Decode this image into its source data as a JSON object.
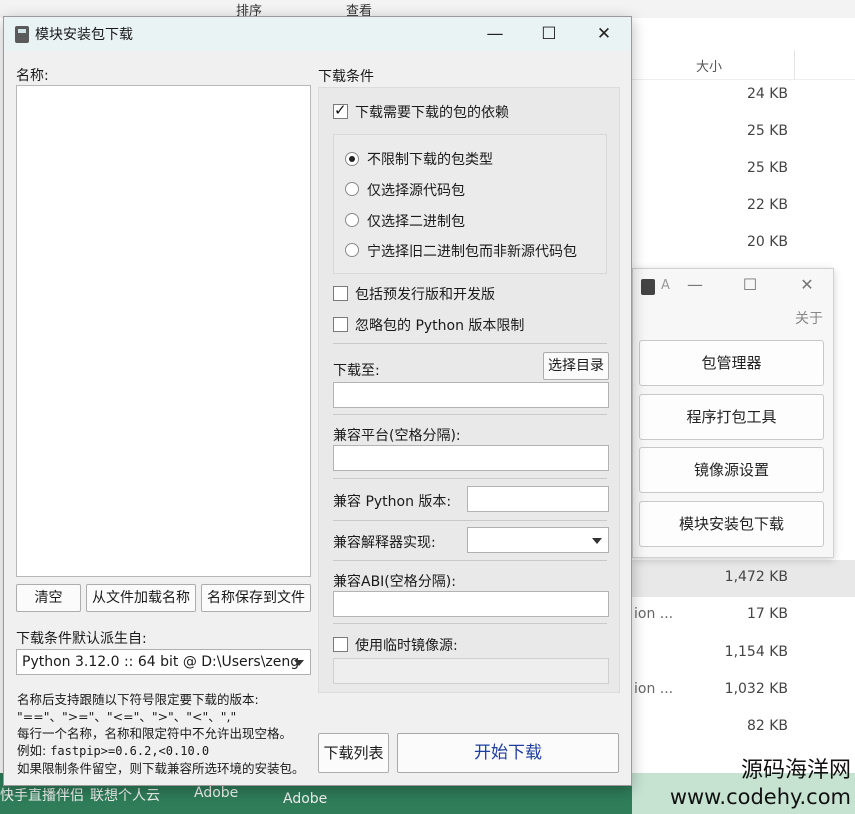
{
  "background": {
    "toolbar_items": [
      "排序",
      "查看"
    ],
    "size_header": "大小",
    "files": [
      {
        "name": "",
        "size": "24 KB"
      },
      {
        "name": "",
        "size": "25 KB"
      },
      {
        "name": "",
        "size": "25 KB"
      },
      {
        "name": "",
        "size": "22 KB"
      },
      {
        "name": "",
        "size": "20 KB"
      },
      {
        "name": "",
        "size": "1,472 KB",
        "selected": true
      },
      {
        "name": "ion ...",
        "size": "17 KB"
      },
      {
        "name": "",
        "size": "1,154 KB"
      },
      {
        "name": "ion ...",
        "size": "1,032 KB"
      },
      {
        "name": "",
        "size": "82 KB"
      }
    ],
    "taskbar_texts": [
      "快手直播伴侣",
      "联想个人云",
      "Adobe",
      "Adobe"
    ]
  },
  "mini_window": {
    "title": "A",
    "about": "关于",
    "buttons": [
      "包管理器",
      "程序打包工具",
      "镜像源设置",
      "模块安装包下载"
    ]
  },
  "dialog": {
    "title": "模块安装包下载",
    "names_label": "名称:",
    "clear_button": "清空",
    "load_button": "从文件加载名称",
    "save_button": "名称保存到文件",
    "derive_label": "下载条件默认派生自:",
    "python_select_value": "Python 3.12.0 :: 64 bit @ D:\\Users\\zeng",
    "hint_line1": "名称后支持跟随以下符号限定要下载的版本:",
    "hint_line2": "\"==\"、\">=\"、\"<=\"、\">\"、\"<\"、\",\"",
    "hint_line3": "每行一个名称，名称和限定符中不允许出现空格。",
    "hint_line4_prefix": "例如: ",
    "hint_line4_code": "fastpip>=0.6.2,<0.10.0",
    "hint_line5": "如果限制条件留空，则下载兼容所选环境的安装包。",
    "conditions_label": "下载条件",
    "deps_checkbox": "下载需要下载的包的依赖",
    "deps_checked": true,
    "radio_options": [
      "不限制下载的包类型",
      "仅选择源代码包",
      "仅选择二进制包",
      "宁选择旧二进制包而非新源代码包"
    ],
    "radio_selected": 0,
    "prerelease_checkbox": "包括预发行版和开发版",
    "ignore_python_checkbox": "忽略包的 Python 版本限制",
    "download_to_label": "下载至:",
    "choose_dir_button": "选择目录",
    "platform_label": "兼容平台(空格分隔):",
    "python_version_label": "兼容 Python 版本:",
    "interpreter_label": "兼容解释器实现:",
    "abi_label": "兼容ABI(空格分隔):",
    "temp_mirror_checkbox": "使用临时镜像源:",
    "download_list_button": "下载列表",
    "start_button": "开始下载"
  },
  "watermark": {
    "line1": "源码海洋网",
    "line2": "www.codehy.com"
  }
}
